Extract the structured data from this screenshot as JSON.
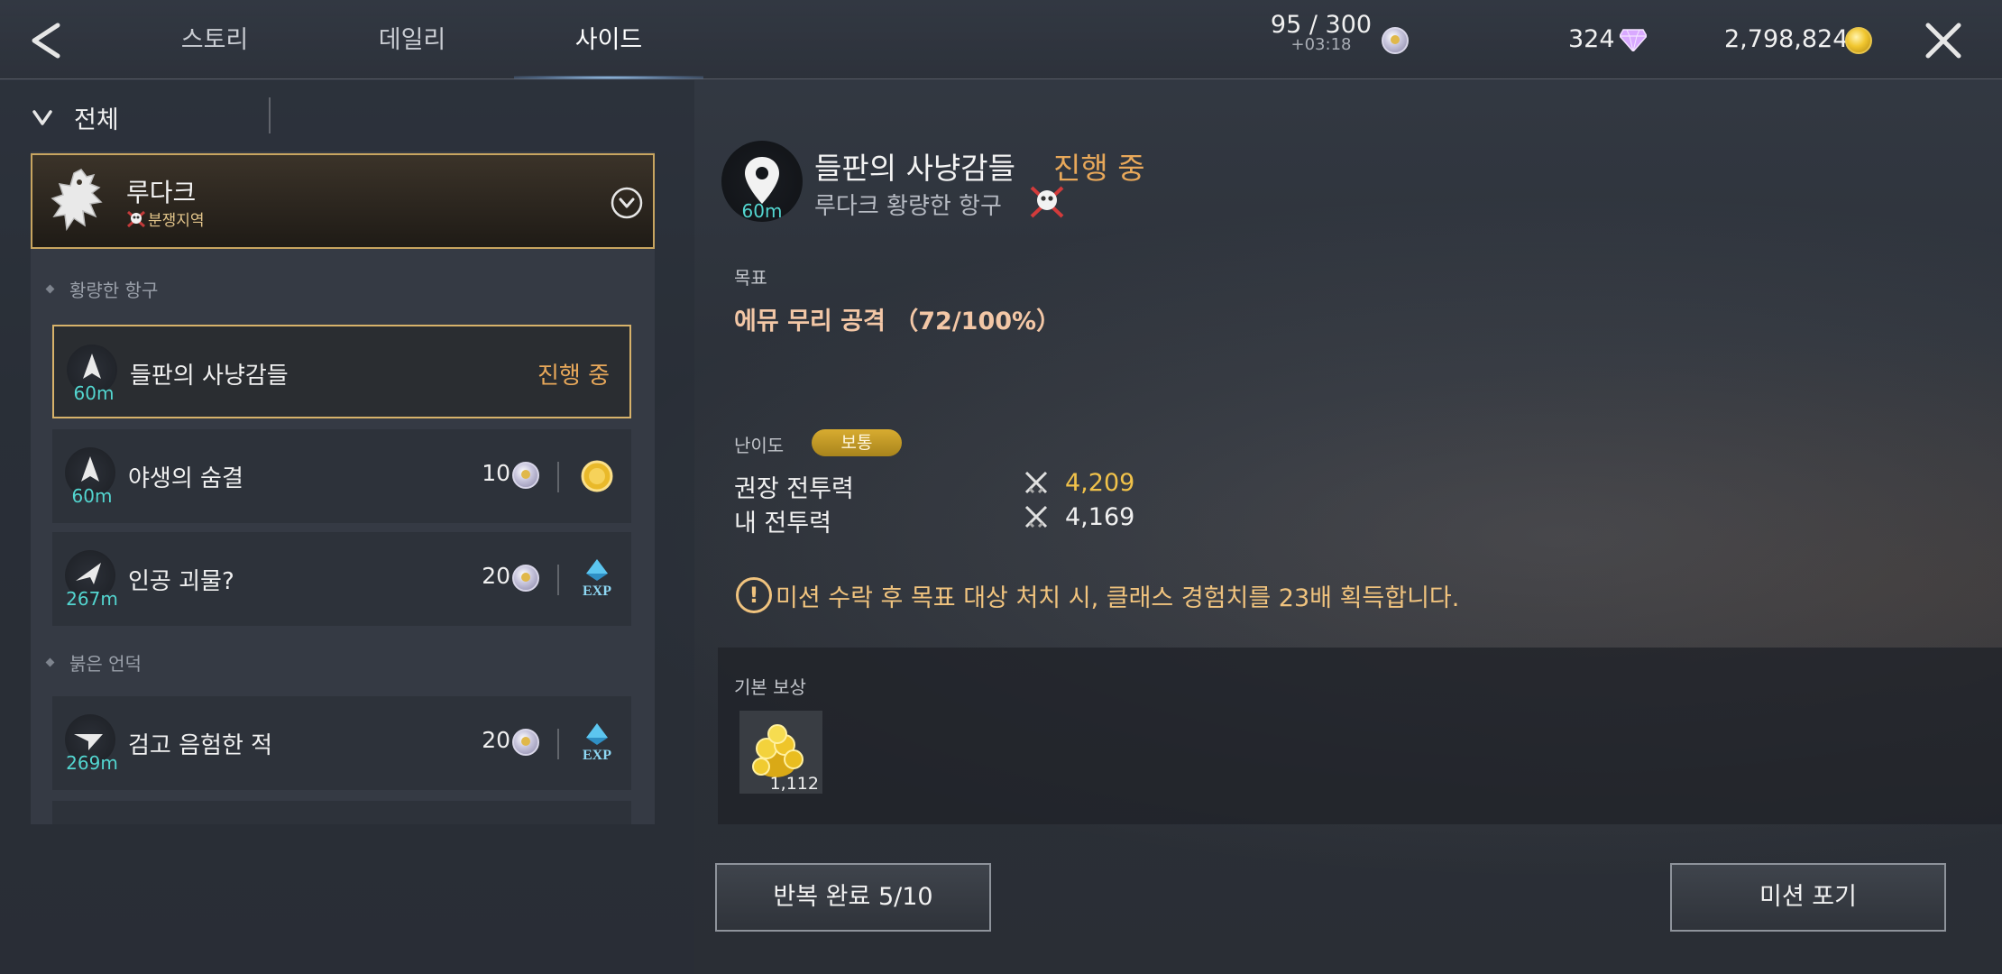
{
  "tabs": [
    {
      "label": "스토리",
      "active": false
    },
    {
      "label": "데일리",
      "active": false
    },
    {
      "label": "사이드",
      "active": true
    }
  ],
  "header": {
    "stamina": "95 / 300",
    "stamina_timer": "+03:18",
    "gems": "324",
    "gold": "2,798,824"
  },
  "filter": {
    "label": "전체"
  },
  "region": {
    "name": "루다크",
    "tag": "분쟁지역"
  },
  "sections": [
    {
      "label": "황량한 항구"
    },
    {
      "label": "붉은 언덕"
    }
  ],
  "quests": [
    {
      "distance": "60m",
      "title": "들판의 사냥감들",
      "status": "진행 중"
    },
    {
      "distance": "60m",
      "title": "야생의 숨결",
      "cost": "10",
      "reward_icon": "gold-coin-icon"
    },
    {
      "distance": "267m",
      "title": "인공 괴물?",
      "cost": "20",
      "reward_icon": "exp-icon"
    },
    {
      "distance": "269m",
      "title": "검고 음험한 적",
      "cost": "20",
      "reward_icon": "exp-icon"
    }
  ],
  "detail": {
    "distance": "60m",
    "title": "들판의 사냥감들",
    "status": "진행 중",
    "location": "루다크 황량한 항구",
    "objective_label": "목표",
    "objective": "에뮤 무리 공격 （72/100%）",
    "difficulty_label": "난이도",
    "difficulty": "보통",
    "recommended_power_label": "권장 전투력",
    "recommended_power": "4,209",
    "my_power_label": "내 전투력",
    "my_power": "4,169",
    "notice": "미션 수락 후 목표 대상 처치 시, 클래스 경험치를 23배 획득합니다.",
    "reward_label": "기본 보상",
    "reward_qty": "1,112"
  },
  "buttons": {
    "repeat": "반복 완료 5/10",
    "abandon": "미션 포기"
  },
  "colors": {
    "accent_orange": "#e8a85a",
    "distance_teal": "#53d6d0",
    "gold_border": "#c8a560",
    "recommended_power": "#f1c24a"
  }
}
